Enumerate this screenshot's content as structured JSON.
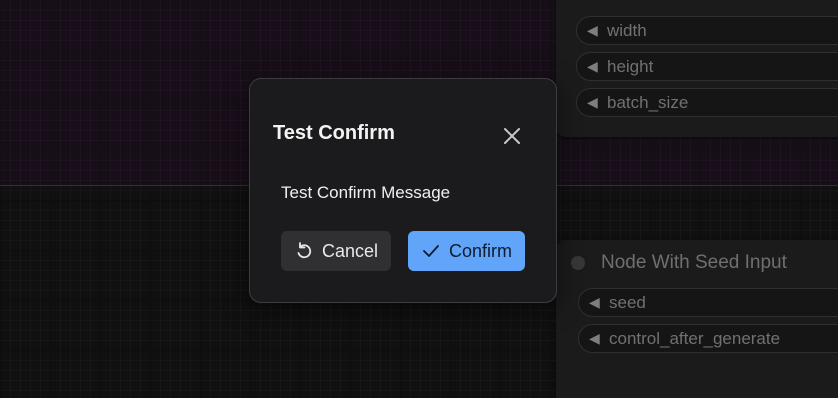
{
  "canvas": {
    "top_node": {
      "widgets": [
        {
          "label": "width",
          "arrow_icon": "triangle-left-icon"
        },
        {
          "label": "height",
          "arrow_icon": "triangle-left-icon"
        },
        {
          "label": "batch_size",
          "arrow_icon": "triangle-left-icon"
        }
      ]
    },
    "seed_node": {
      "title": "Node With Seed Input",
      "widgets": [
        {
          "label": "seed",
          "arrow_icon": "triangle-left-icon"
        },
        {
          "label": "control_after_generate",
          "arrow_icon": "triangle-left-icon"
        }
      ]
    },
    "colors": {
      "group_background": "#1e1220",
      "canvas_background": "#141414"
    }
  },
  "dialog": {
    "title": "Test Confirm",
    "message": "Test Confirm Message",
    "close_icon": "close-icon",
    "cancel": {
      "label": "Cancel",
      "icon": "undo-icon"
    },
    "confirm": {
      "label": "Confirm",
      "icon": "check-icon"
    },
    "colors": {
      "primary": "#60a5fa",
      "secondary": "#303032",
      "surface": "#1b1b1d"
    }
  }
}
